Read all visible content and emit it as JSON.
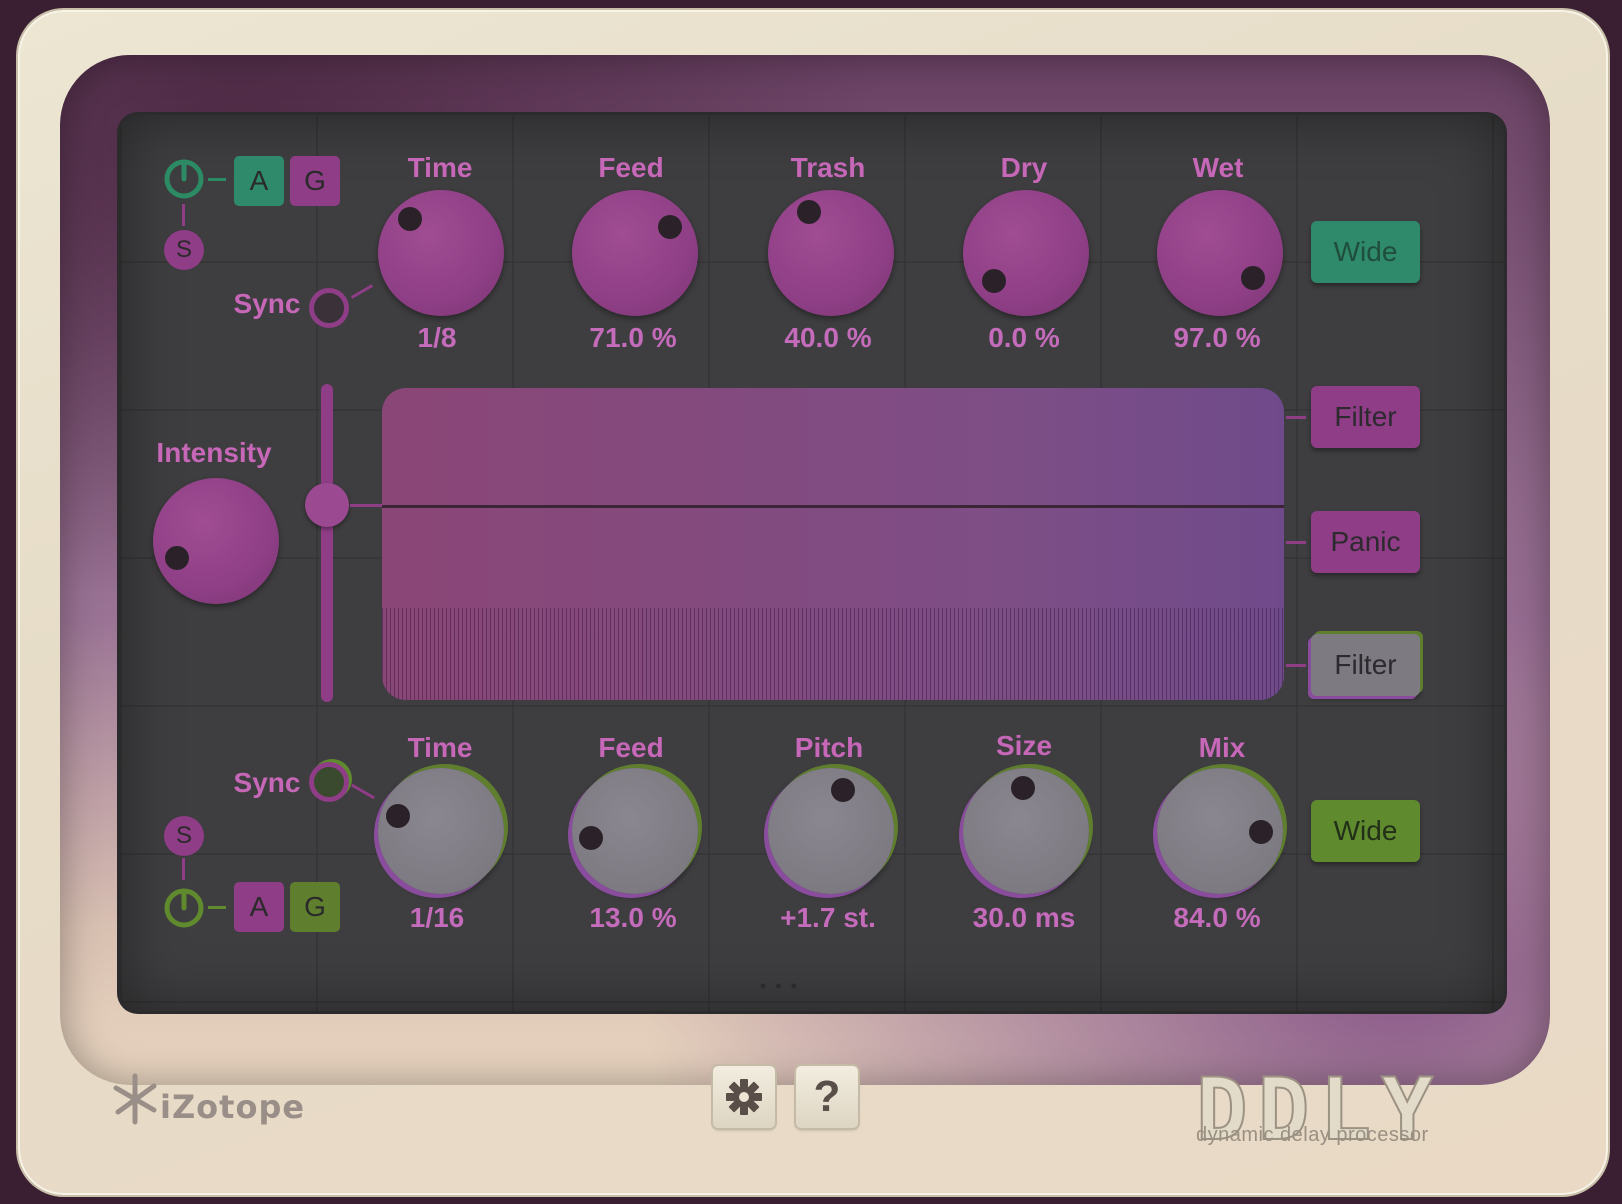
{
  "top_row": {
    "knobs": [
      {
        "label": "Time",
        "value": "1/8"
      },
      {
        "label": "Feed",
        "value": "71.0 %"
      },
      {
        "label": "Trash",
        "value": "40.0 %"
      },
      {
        "label": "Dry",
        "value": "0.0 %"
      },
      {
        "label": "Wet",
        "value": "97.0 %"
      }
    ],
    "sync_label": "Sync",
    "a_label": "A",
    "g_label": "G",
    "s_label": "S",
    "wide_label": "Wide"
  },
  "middle": {
    "intensity_label": "Intensity",
    "filter_top_label": "Filter",
    "panic_label": "Panic",
    "filter_bottom_label": "Filter"
  },
  "bottom_row": {
    "knobs": [
      {
        "label": "Time",
        "value": "1/16"
      },
      {
        "label": "Feed",
        "value": "13.0 %"
      },
      {
        "label": "Pitch",
        "value": "+1.7 st."
      },
      {
        "label": "Size",
        "value": "30.0 ms"
      },
      {
        "label": "Mix",
        "value": "84.0 %"
      }
    ],
    "sync_label": "Sync",
    "a_label": "A",
    "g_label": "G",
    "s_label": "S",
    "wide_label": "Wide"
  },
  "footer": {
    "more_label": "• • •",
    "help_label": "?",
    "brand": "iZotope",
    "product": "DDLY",
    "product_sub": "dynamic delay processor"
  },
  "icons": {
    "power": "power-icon",
    "settings": "gear-icon",
    "help": "help-icon"
  },
  "colors": {
    "accent_purple": "#c667b8",
    "knob_purple": "#8f3f86",
    "green": "#2e8a6a",
    "lime": "#5f8a2e",
    "screen": "#3e3d3f"
  }
}
